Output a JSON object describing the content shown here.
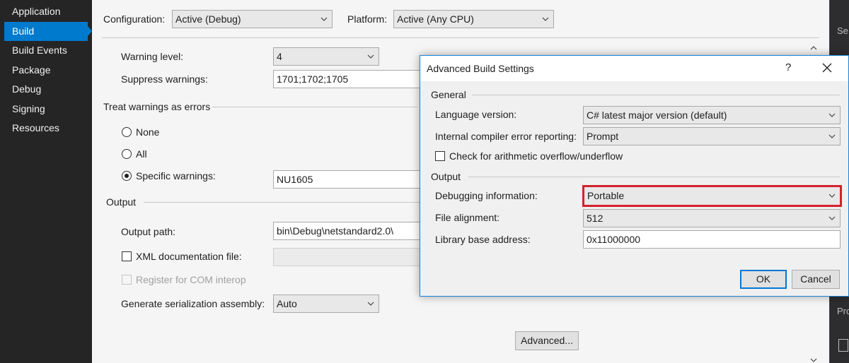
{
  "sidebar": {
    "items": [
      {
        "label": "Application",
        "active": false
      },
      {
        "label": "Build",
        "active": true
      },
      {
        "label": "Build Events",
        "active": false
      },
      {
        "label": "Package",
        "active": false
      },
      {
        "label": "Debug",
        "active": false
      },
      {
        "label": "Signing",
        "active": false
      },
      {
        "label": "Resources",
        "active": false
      }
    ]
  },
  "top": {
    "configuration_label": "Configuration:",
    "configuration_value": "Active (Debug)",
    "platform_label": "Platform:",
    "platform_value": "Active (Any CPU)"
  },
  "errors": {
    "warning_level_label": "Warning level:",
    "warning_level_value": "4",
    "suppress_label": "Suppress warnings:",
    "suppress_value": "1701;1702;1705"
  },
  "treat_warnings": {
    "section_label": "Treat warnings as errors",
    "none_label": "None",
    "all_label": "All",
    "specific_label": "Specific warnings:",
    "specific_value": "NU1605",
    "selected": "specific"
  },
  "output": {
    "section_label": "Output",
    "path_label": "Output path:",
    "path_value": "bin\\Debug\\netstandard2.0\\",
    "xml_doc_label": "XML documentation file:",
    "xml_doc_value": "",
    "com_label": "Register for COM interop",
    "serialization_label": "Generate serialization assembly:",
    "serialization_value": "Auto",
    "advanced_button": "Advanced..."
  },
  "right_panel": {
    "top_text": "Se",
    "bottom_text": "Pro"
  },
  "dialog": {
    "title": "Advanced Build Settings",
    "help": "?",
    "general_section": "General",
    "language_label": "Language version:",
    "language_value": "C# latest major version (default)",
    "ice_label": "Internal compiler error reporting:",
    "ice_value": "Prompt",
    "overflow_label": "Check for arithmetic overflow/underflow",
    "output_section": "Output",
    "debug_info_label": "Debugging information:",
    "debug_info_value": "Portable",
    "alignment_label": "File alignment:",
    "alignment_value": "512",
    "base_address_label": "Library base address:",
    "base_address_value": "0x11000000",
    "ok_button": "OK",
    "cancel_button": "Cancel"
  },
  "colors": {
    "sidebar_bg": "#252526",
    "active_nav": "#007acc",
    "highlight_border": "#d4222c",
    "dialog_border": "#1883d7"
  }
}
